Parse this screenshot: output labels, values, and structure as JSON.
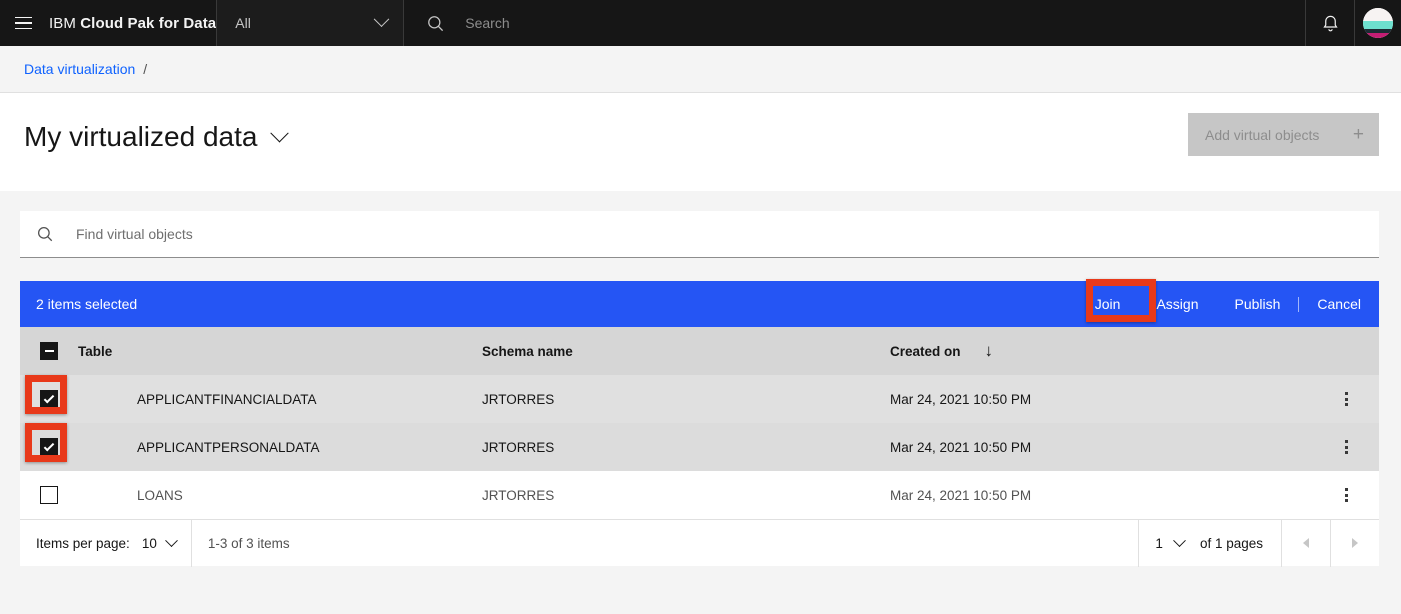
{
  "header": {
    "menu_icon": "hamburger-icon",
    "brand_prefix": "IBM",
    "brand_name": "Cloud Pak for Data",
    "scope_select_value": "All",
    "search_placeholder": "Search",
    "search_icon": "search-icon",
    "notifications_icon": "bell-icon",
    "avatar_icon": "user-avatar"
  },
  "breadcrumb": {
    "items": [
      {
        "label": "Data virtualization"
      }
    ],
    "separator": "/"
  },
  "page": {
    "title": "My virtualized data",
    "title_chevron_icon": "chevron-down-icon",
    "add_button_label": "Add virtual objects",
    "add_button_icon": "plus-icon",
    "add_button_disabled": true
  },
  "search": {
    "placeholder": "Find virtual objects",
    "value": "",
    "icon": "search-icon"
  },
  "batch_bar": {
    "selection_text": "2 items selected",
    "background": "#2555f4",
    "actions": [
      {
        "label": "Join",
        "name": "join-button",
        "highlighted": true
      },
      {
        "label": "Assign",
        "name": "assign-button",
        "highlighted": false
      },
      {
        "label": "Publish",
        "name": "publish-button",
        "highlighted": false
      },
      {
        "label": "Cancel",
        "name": "cancel-button",
        "highlighted": false
      }
    ]
  },
  "table": {
    "select_all_state": "indeterminate",
    "columns": [
      {
        "label": "Table",
        "sorted": false
      },
      {
        "label": "Schema name",
        "sorted": false
      },
      {
        "label": "Created on",
        "sorted": true,
        "sort_icon": "arrow-down-icon"
      }
    ],
    "rows": [
      {
        "name": "APPLICANTFINANCIALDATA",
        "schema": "JRTORRES",
        "created": "Mar 24, 2021 10:50 PM",
        "selected": true,
        "overflow_icon": "overflow-menu-icon"
      },
      {
        "name": "APPLICANTPERSONALDATA",
        "schema": "JRTORRES",
        "created": "Mar 24, 2021 10:50 PM",
        "selected": true,
        "overflow_icon": "overflow-menu-icon"
      },
      {
        "name": "LOANS",
        "schema": "JRTORRES",
        "created": "Mar 24, 2021 10:50 PM",
        "selected": false,
        "overflow_icon": "overflow-menu-icon"
      }
    ]
  },
  "pagination": {
    "items_per_page_label": "Items per page:",
    "items_per_page_value": "10",
    "range_text": "1-3 of 3 items",
    "current_page": "1",
    "of_pages_text": "of 1 pages",
    "prev_icon": "caret-left-icon",
    "next_icon": "caret-right-icon",
    "prev_disabled": true,
    "next_disabled": true
  },
  "annotations": {
    "color": "#e8391a",
    "boxes": [
      {
        "target": "join-button"
      },
      {
        "target": "row-checkbox-0"
      },
      {
        "target": "row-checkbox-1"
      }
    ]
  }
}
